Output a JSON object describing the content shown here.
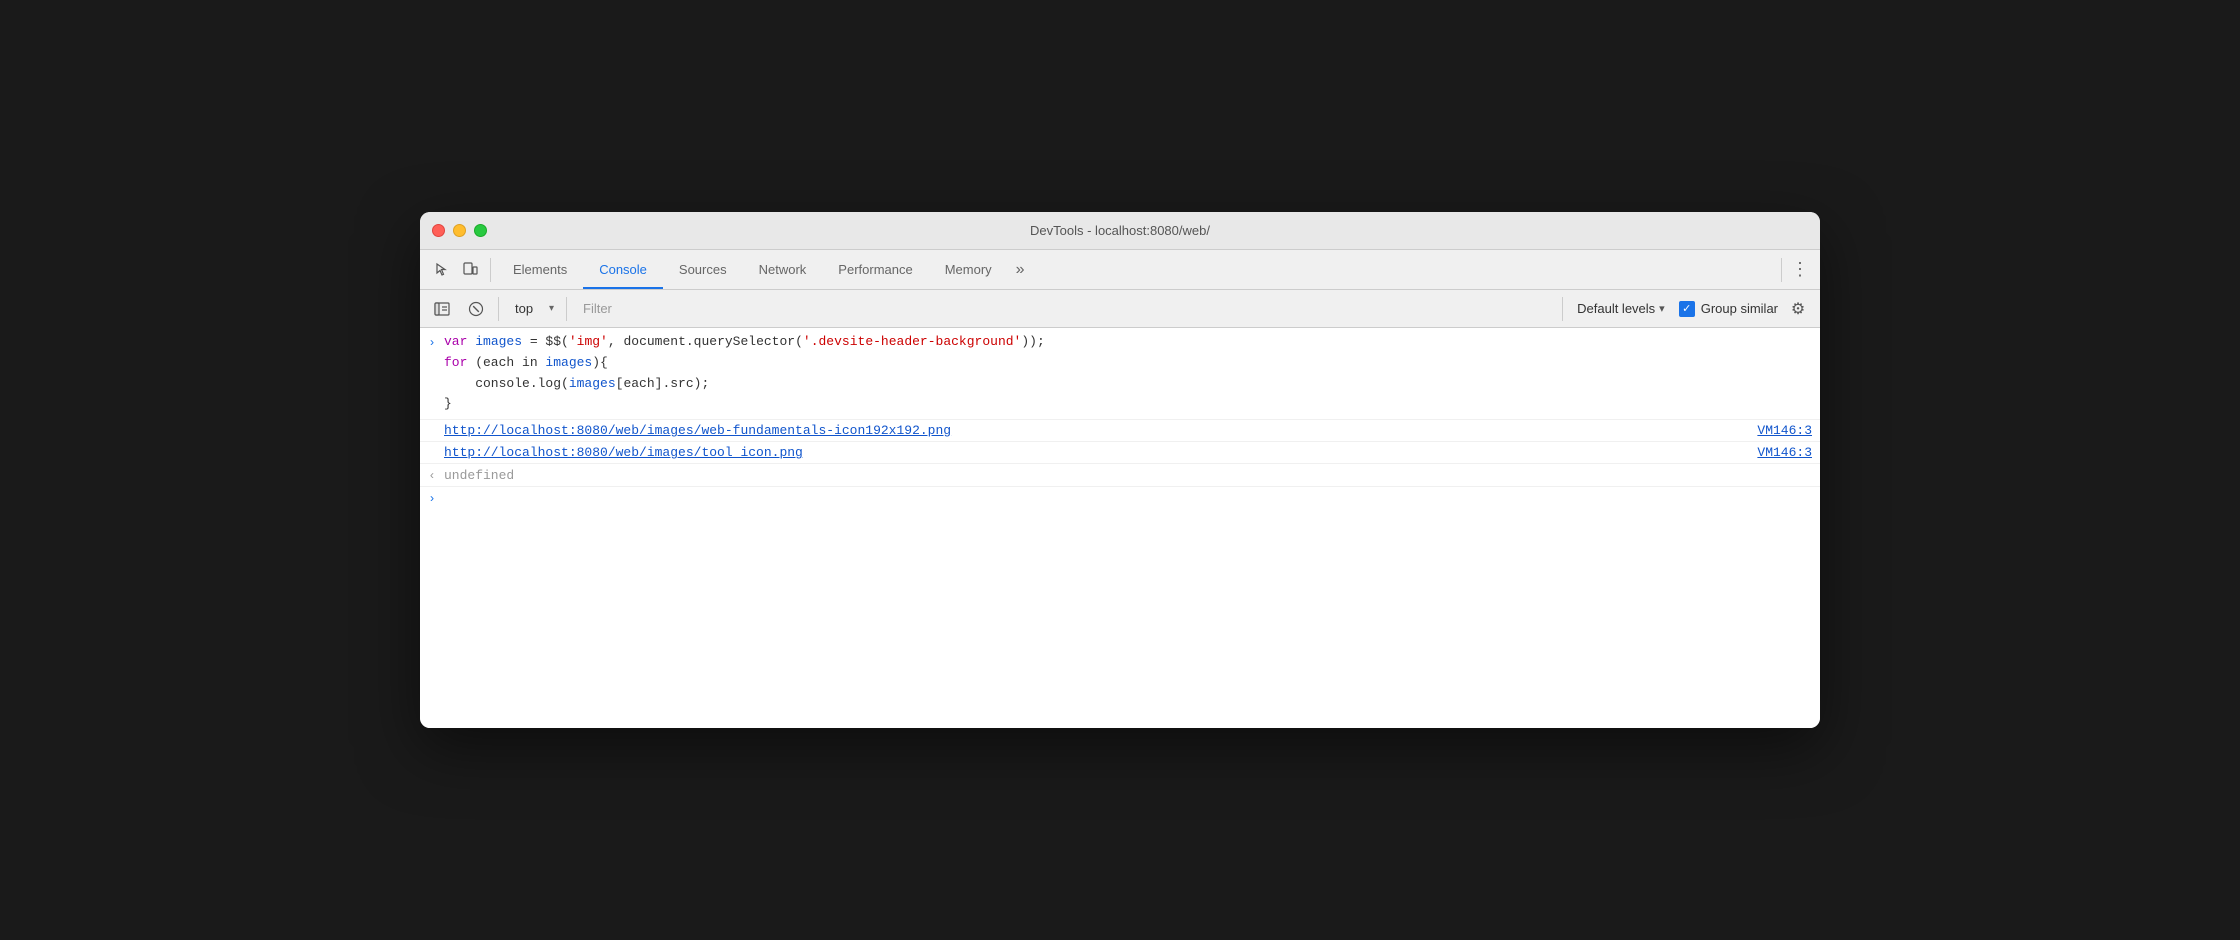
{
  "window": {
    "title": "DevTools - localhost:8080/web/"
  },
  "tabs": [
    {
      "id": "elements",
      "label": "Elements",
      "active": false
    },
    {
      "id": "console",
      "label": "Console",
      "active": true
    },
    {
      "id": "sources",
      "label": "Sources",
      "active": false
    },
    {
      "id": "network",
      "label": "Network",
      "active": false
    },
    {
      "id": "performance",
      "label": "Performance",
      "active": false
    },
    {
      "id": "memory",
      "label": "Memory",
      "active": false
    }
  ],
  "console_toolbar": {
    "context_options": [
      "top"
    ],
    "context_selected": "top",
    "filter_placeholder": "Filter",
    "default_levels_label": "Default levels",
    "group_similar_label": "Group similar"
  },
  "console_output": {
    "code_lines": [
      "var images = $$('img', document.querySelector('.devsite-header-background'));",
      "for (each in images){",
      "    console.log(images[each].src);",
      "}"
    ],
    "links": [
      {
        "url": "http://localhost:8080/web/images/web-fundamentals-icon192x192.png",
        "source": "VM146:3"
      },
      {
        "url": "http://localhost:8080/web/images/tool_icon.png",
        "source": "VM146:3"
      }
    ],
    "undefined_text": "undefined"
  },
  "icons": {
    "cursor": "⬆",
    "drawer": "▭",
    "more_tabs": "»",
    "menu": "⋮",
    "sidebar_toggle": "▶",
    "no_log": "⊘",
    "chevron_right": "›",
    "chevron_left": "‹",
    "chevron_down": "▾",
    "settings": "⚙",
    "checkmark": "✓"
  }
}
